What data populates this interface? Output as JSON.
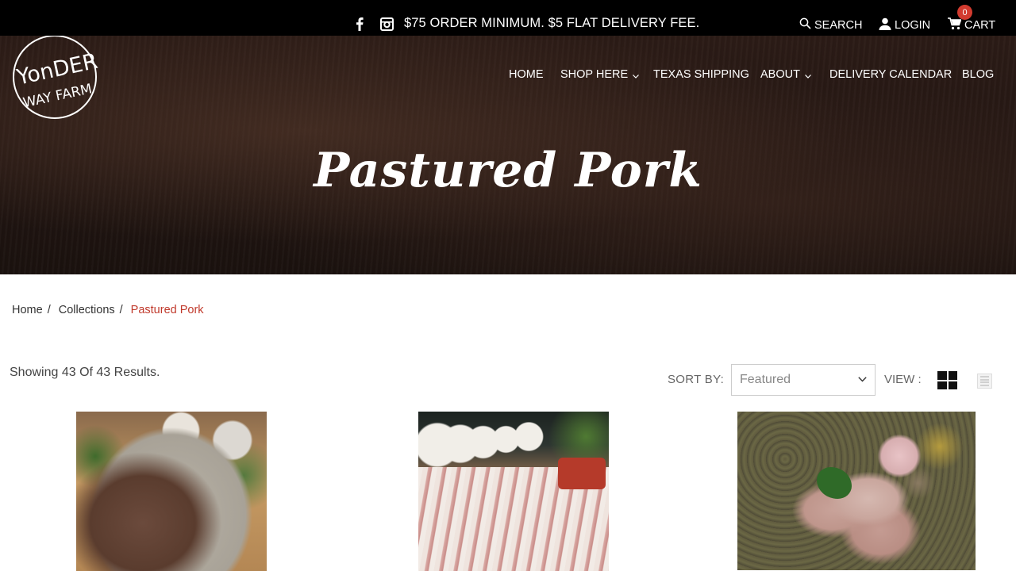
{
  "topbar": {
    "promo": "$75 ORDER MINIMUM. $5 FLAT DELIVERY FEE.",
    "social": [
      "facebook-icon",
      "instagram-icon"
    ],
    "search_label": "SEARCH",
    "login_label": "LOGIN",
    "cart_label": "CART",
    "cart_count": "0",
    "badge_color": "#d23b2f"
  },
  "logo": {
    "line1": "YonDER",
    "line2": "WAY FARM"
  },
  "nav": {
    "items": [
      {
        "label": "HOME",
        "dropdown": false
      },
      {
        "label": "SHOP HERE",
        "dropdown": true
      },
      {
        "label": "TEXAS SHIPPING",
        "dropdown": false
      },
      {
        "label": "ABOUT",
        "dropdown": true
      },
      {
        "label": "DELIVERY CALENDAR",
        "dropdown": false
      },
      {
        "label": "BLOG",
        "dropdown": false
      }
    ],
    "chevron": "⌄"
  },
  "hero": {
    "title": "Pastured Pork"
  },
  "breadcrumb": {
    "items": [
      "Home",
      "Collections"
    ],
    "separator": "/",
    "current": "Pastured Pork",
    "current_color": "#c0392b"
  },
  "toolbar": {
    "results": "Showing 43 Of 43 Results.",
    "sort_label": "SORT BY:",
    "sort_value": "Featured",
    "view_label": "VIEW :"
  },
  "products": [
    {
      "image": "ground-pork-photo"
    },
    {
      "image": "bacon-photo"
    },
    {
      "image": "sausage-photo"
    }
  ]
}
